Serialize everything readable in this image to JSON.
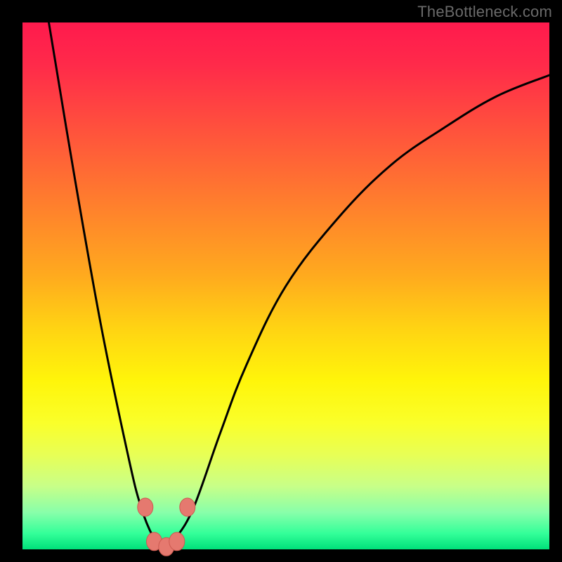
{
  "watermark": {
    "text": "TheBottleneck.com"
  },
  "colors": {
    "background": "#000000",
    "curve_stroke": "#000000",
    "marker_fill": "#e5796f",
    "marker_stroke": "#cc5a50"
  },
  "chart_data": {
    "type": "line",
    "title": "",
    "xlabel": "",
    "ylabel": "",
    "xlim": [
      0,
      100
    ],
    "ylim": [
      0,
      100
    ],
    "grid": false,
    "legend": false,
    "series": [
      {
        "name": "bottleneck-curve",
        "x": [
          5,
          10,
          15,
          20,
          22.5,
          25,
          27,
          29,
          32.5,
          37.5,
          42.5,
          50,
          60,
          70,
          80,
          90,
          100
        ],
        "y": [
          100,
          70,
          42,
          18,
          8,
          2,
          0,
          2,
          8,
          22,
          35,
          50,
          63,
          73,
          80,
          86,
          90
        ]
      }
    ],
    "markers": [
      {
        "x": 23.3,
        "y": 8
      },
      {
        "x": 25.0,
        "y": 1.5
      },
      {
        "x": 27.3,
        "y": 0.5
      },
      {
        "x": 29.3,
        "y": 1.5
      },
      {
        "x": 31.3,
        "y": 8
      }
    ],
    "gradient_stops": [
      {
        "pct": 0,
        "color": "#ff1a4d"
      },
      {
        "pct": 50,
        "color": "#ffcf13"
      },
      {
        "pct": 80,
        "color": "#f5ff2a"
      },
      {
        "pct": 100,
        "color": "#00e07a"
      }
    ]
  }
}
